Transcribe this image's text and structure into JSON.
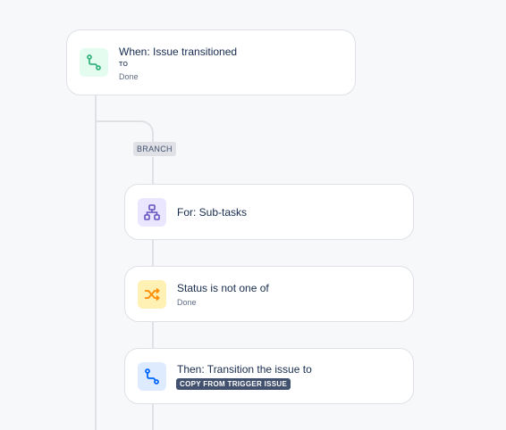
{
  "trigger": {
    "title": "When: Issue transitioned",
    "to_label": "TO",
    "to_value": "Done",
    "icon": "transition-icon",
    "icon_bg": "#e3fcef",
    "icon_color": "#36b37e"
  },
  "branch": {
    "label": "BRANCH"
  },
  "branch_rule": {
    "title": "For: Sub-tasks",
    "icon": "hierarchy-icon",
    "icon_bg": "#eae6ff",
    "icon_color": "#6554c0"
  },
  "condition": {
    "title": "Status is not one of",
    "value": "Done",
    "icon": "shuffle-icon",
    "icon_bg": "#fff0b3",
    "icon_color": "#ff8b00"
  },
  "action": {
    "title": "Then: Transition the issue to",
    "value": "COPY FROM TRIGGER ISSUE",
    "icon": "transition-icon",
    "icon_bg": "#deebff",
    "icon_color": "#0065ff"
  }
}
